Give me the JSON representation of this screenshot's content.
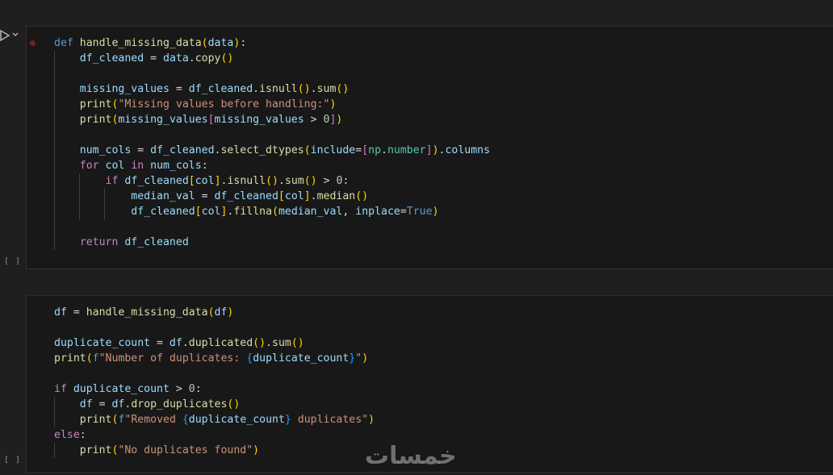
{
  "cell1": {
    "exec_count": "[ ]",
    "lines": [
      [
        [
          "kw",
          "def"
        ],
        [
          "op",
          " "
        ],
        [
          "fn",
          "handle_missing_data"
        ],
        [
          "b1",
          "("
        ],
        [
          "var",
          "data"
        ],
        [
          "b1",
          ")"
        ],
        [
          "op",
          ":"
        ]
      ],
      [
        [
          "op",
          "    "
        ],
        [
          "var",
          "df_cleaned"
        ],
        [
          "op",
          " = "
        ],
        [
          "var",
          "data"
        ],
        [
          "op",
          "."
        ],
        [
          "fn",
          "copy"
        ],
        [
          "b1",
          "()"
        ]
      ],
      [],
      [
        [
          "op",
          "    "
        ],
        [
          "var",
          "missing_values"
        ],
        [
          "op",
          " = "
        ],
        [
          "var",
          "df_cleaned"
        ],
        [
          "op",
          "."
        ],
        [
          "fn",
          "isnull"
        ],
        [
          "b1",
          "()"
        ],
        [
          "op",
          "."
        ],
        [
          "fn",
          "sum"
        ],
        [
          "b1",
          "()"
        ]
      ],
      [
        [
          "op",
          "    "
        ],
        [
          "fn",
          "print"
        ],
        [
          "b1",
          "("
        ],
        [
          "str",
          "\"Missing values before handling:\""
        ],
        [
          "b1",
          ")"
        ]
      ],
      [
        [
          "op",
          "    "
        ],
        [
          "fn",
          "print"
        ],
        [
          "b1",
          "("
        ],
        [
          "var",
          "missing_values"
        ],
        [
          "b2",
          "["
        ],
        [
          "var",
          "missing_values"
        ],
        [
          "op",
          " > "
        ],
        [
          "num",
          "0"
        ],
        [
          "b2",
          "]"
        ],
        [
          "b1",
          ")"
        ]
      ],
      [],
      [
        [
          "op",
          "    "
        ],
        [
          "var",
          "num_cols"
        ],
        [
          "op",
          " = "
        ],
        [
          "var",
          "df_cleaned"
        ],
        [
          "op",
          "."
        ],
        [
          "fn",
          "select_dtypes"
        ],
        [
          "b1",
          "("
        ],
        [
          "var",
          "include"
        ],
        [
          "op",
          "="
        ],
        [
          "b2",
          "["
        ],
        [
          "cls",
          "np"
        ],
        [
          "op",
          "."
        ],
        [
          "cls",
          "number"
        ],
        [
          "b2",
          "]"
        ],
        [
          "b1",
          ")"
        ],
        [
          "op",
          "."
        ],
        [
          "var",
          "columns"
        ]
      ],
      [
        [
          "op",
          "    "
        ],
        [
          "ctl",
          "for"
        ],
        [
          "op",
          " "
        ],
        [
          "var",
          "col"
        ],
        [
          "op",
          " "
        ],
        [
          "ctl",
          "in"
        ],
        [
          "op",
          " "
        ],
        [
          "var",
          "num_cols"
        ],
        [
          "op",
          ":"
        ]
      ],
      [
        [
          "op",
          "        "
        ],
        [
          "ctl",
          "if"
        ],
        [
          "op",
          " "
        ],
        [
          "var",
          "df_cleaned"
        ],
        [
          "b1",
          "["
        ],
        [
          "var",
          "col"
        ],
        [
          "b1",
          "]"
        ],
        [
          "op",
          "."
        ],
        [
          "fn",
          "isnull"
        ],
        [
          "b1",
          "()"
        ],
        [
          "op",
          "."
        ],
        [
          "fn",
          "sum"
        ],
        [
          "b1",
          "()"
        ],
        [
          "op",
          " > "
        ],
        [
          "num",
          "0"
        ],
        [
          "op",
          ":"
        ]
      ],
      [
        [
          "op",
          "            "
        ],
        [
          "var",
          "median_val"
        ],
        [
          "op",
          " = "
        ],
        [
          "var",
          "df_cleaned"
        ],
        [
          "b1",
          "["
        ],
        [
          "var",
          "col"
        ],
        [
          "b1",
          "]"
        ],
        [
          "op",
          "."
        ],
        [
          "fn",
          "median"
        ],
        [
          "b1",
          "()"
        ]
      ],
      [
        [
          "op",
          "            "
        ],
        [
          "var",
          "df_cleaned"
        ],
        [
          "b1",
          "["
        ],
        [
          "var",
          "col"
        ],
        [
          "b1",
          "]"
        ],
        [
          "op",
          "."
        ],
        [
          "fn",
          "fillna"
        ],
        [
          "b1",
          "("
        ],
        [
          "var",
          "median_val"
        ],
        [
          "op",
          ", "
        ],
        [
          "var",
          "inplace"
        ],
        [
          "op",
          "="
        ],
        [
          "cst",
          "True"
        ],
        [
          "b1",
          ")"
        ]
      ],
      [],
      [
        [
          "op",
          "    "
        ],
        [
          "ctl",
          "return"
        ],
        [
          "op",
          " "
        ],
        [
          "var",
          "df_cleaned"
        ]
      ]
    ]
  },
  "cell2": {
    "exec_count": "[ ]",
    "lines": [
      [
        [
          "var",
          "df"
        ],
        [
          "op",
          " = "
        ],
        [
          "fn",
          "handle_missing_data"
        ],
        [
          "b1",
          "("
        ],
        [
          "var",
          "df"
        ],
        [
          "b1",
          ")"
        ]
      ],
      [],
      [
        [
          "var",
          "duplicate_count"
        ],
        [
          "op",
          " = "
        ],
        [
          "var",
          "df"
        ],
        [
          "op",
          "."
        ],
        [
          "fn",
          "duplicated"
        ],
        [
          "b1",
          "()"
        ],
        [
          "op",
          "."
        ],
        [
          "fn",
          "sum"
        ],
        [
          "b1",
          "()"
        ]
      ],
      [
        [
          "fn",
          "print"
        ],
        [
          "b1",
          "("
        ],
        [
          "kw",
          "f"
        ],
        [
          "str",
          "\"Number of duplicates: "
        ],
        [
          "b3",
          "{"
        ],
        [
          "var",
          "duplicate_count"
        ],
        [
          "b3",
          "}"
        ],
        [
          "str",
          "\""
        ],
        [
          "b1",
          ")"
        ]
      ],
      [],
      [
        [
          "ctl",
          "if"
        ],
        [
          "op",
          " "
        ],
        [
          "var",
          "duplicate_count"
        ],
        [
          "op",
          " > "
        ],
        [
          "num",
          "0"
        ],
        [
          "op",
          ":"
        ]
      ],
      [
        [
          "op",
          "    "
        ],
        [
          "var",
          "df"
        ],
        [
          "op",
          " = "
        ],
        [
          "var",
          "df"
        ],
        [
          "op",
          "."
        ],
        [
          "fn",
          "drop_duplicates"
        ],
        [
          "b1",
          "()"
        ]
      ],
      [
        [
          "op",
          "    "
        ],
        [
          "fn",
          "print"
        ],
        [
          "b1",
          "("
        ],
        [
          "kw",
          "f"
        ],
        [
          "str",
          "\"Removed "
        ],
        [
          "b3",
          "{"
        ],
        [
          "var",
          "duplicate_count"
        ],
        [
          "b3",
          "}"
        ],
        [
          "str",
          " duplicates\""
        ],
        [
          "b1",
          ")"
        ]
      ],
      [
        [
          "ctl",
          "else"
        ],
        [
          "op",
          ":"
        ]
      ],
      [
        [
          "op",
          "    "
        ],
        [
          "fn",
          "print"
        ],
        [
          "b1",
          "("
        ],
        [
          "str",
          "\"No duplicates found\""
        ],
        [
          "b1",
          ")"
        ]
      ]
    ]
  },
  "watermark": "خمسات"
}
